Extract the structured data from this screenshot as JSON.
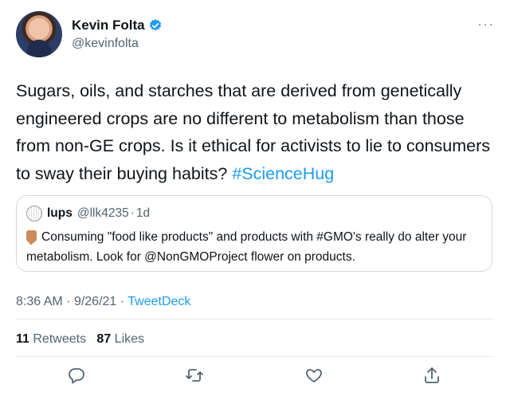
{
  "author": {
    "display_name": "Kevin Folta",
    "handle": "@kevinfolta"
  },
  "tweet": {
    "text": "Sugars, oils, and starches that are derived from genetically engineered crops are no different to metabolism than those from non-GE crops. Is it ethical for activists to lie to consumers to sway their buying habits?",
    "hashtag": "#ScienceHug"
  },
  "quoted": {
    "name": "lups",
    "handle": "@llk4235",
    "separator": "·",
    "time": "1d",
    "text": "Consuming \"food like products\" and products with #GMO's really do alter your metabolism. Look for @NonGMOProject flower on products."
  },
  "timestamp": {
    "time": "8:36 AM",
    "sep1": "·",
    "date": "9/26/21",
    "sep2": "·",
    "source": "TweetDeck"
  },
  "stats": {
    "retweets_count": "11",
    "retweets_label": "Retweets",
    "likes_count": "87",
    "likes_label": "Likes"
  },
  "icons": {
    "more": "more-icon",
    "verified": "verified-badge-icon",
    "reply": "reply-icon",
    "retweet": "retweet-icon",
    "like": "like-icon",
    "share": "share-icon"
  },
  "colors": {
    "accent": "#1d9bf0",
    "secondary_text": "#536471",
    "primary_text": "#0f1419"
  }
}
